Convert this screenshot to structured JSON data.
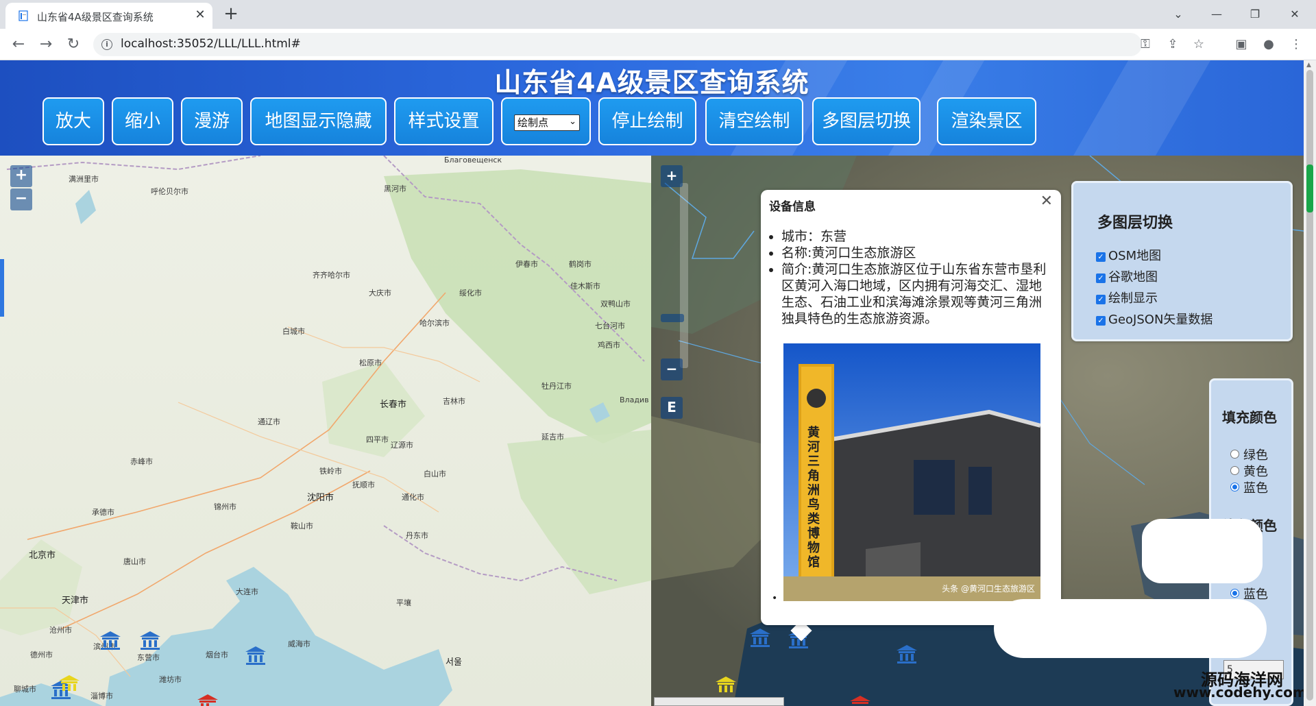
{
  "browser": {
    "tab_title": "山东省4A级景区查询系统",
    "tab_close": "✕",
    "new_tab": "+",
    "url": "localhost:35052/LLL/LLL.html#"
  },
  "header": {
    "title": "山东省4A级景区查询系统",
    "buttons": {
      "zoom_in": "放大",
      "zoom_out": "缩小",
      "pan": "漫游",
      "toggle_map": "地图显示隐藏",
      "style": "样式设置",
      "stop_draw": "停止绘制",
      "clear_draw": "清空绘制",
      "layer_switch": "多图层切换",
      "render_scenic": "渲染景区"
    },
    "draw_select_value": "绘制点"
  },
  "left_map": {
    "zoom_in": "+",
    "zoom_out": "−",
    "labels": [
      {
        "text": "Благовещенск",
        "big": false
      },
      {
        "text": "满洲里市",
        "big": false
      },
      {
        "text": "呼伦贝尔市",
        "big": false
      },
      {
        "text": "黑河市",
        "big": false
      },
      {
        "text": "齐齐哈尔市",
        "big": false
      },
      {
        "text": "大庆市",
        "big": false
      },
      {
        "text": "伊春市",
        "big": false
      },
      {
        "text": "鹤岗市",
        "big": false
      },
      {
        "text": "佳木斯市",
        "big": false
      },
      {
        "text": "双鸭山市",
        "big": false
      },
      {
        "text": "哈尔滨市",
        "big": false
      },
      {
        "text": "绥化市",
        "big": false
      },
      {
        "text": "七台河市",
        "big": false
      },
      {
        "text": "白城市",
        "big": false
      },
      {
        "text": "松原市",
        "big": false
      },
      {
        "text": "鸡西市",
        "big": false
      },
      {
        "text": "牡丹江市",
        "big": false
      },
      {
        "text": "长春市",
        "big": false
      },
      {
        "text": "吉林市",
        "big": false
      },
      {
        "text": "四平市",
        "big": false
      },
      {
        "text": "通辽市",
        "big": false
      },
      {
        "text": "辽源市",
        "big": false
      },
      {
        "text": "延吉市",
        "big": false
      },
      {
        "text": "赤峰市",
        "big": false
      },
      {
        "text": "铁岭市",
        "big": false
      },
      {
        "text": "沈阳市",
        "big": false
      },
      {
        "text": "抚顺市",
        "big": false
      },
      {
        "text": "白山市",
        "big": false
      },
      {
        "text": "通化市",
        "big": false
      },
      {
        "text": "承德市",
        "big": false
      },
      {
        "text": "锦州市",
        "big": false
      },
      {
        "text": "鞍山市",
        "big": false
      },
      {
        "text": "丹东市",
        "big": false
      },
      {
        "text": "北京市",
        "big": true
      },
      {
        "text": "唐山市",
        "big": false
      },
      {
        "text": "天津市",
        "big": true
      },
      {
        "text": "大连市",
        "big": false
      },
      {
        "text": "平壤",
        "big": false
      },
      {
        "text": "沧州市",
        "big": false
      },
      {
        "text": "滨州市",
        "big": false
      },
      {
        "text": "东营市",
        "big": false
      },
      {
        "text": "烟台市",
        "big": false
      },
      {
        "text": "威海市",
        "big": false
      },
      {
        "text": "德州市",
        "big": false
      },
      {
        "text": "淄博市",
        "big": false
      },
      {
        "text": "潍坊市",
        "big": false
      },
      {
        "text": "聊城市",
        "big": false
      },
      {
        "text": "서울",
        "big": false
      },
      {
        "text": "Владив",
        "big": false
      }
    ]
  },
  "right_map": {
    "zoom_in": "+",
    "zoom_out": "−",
    "extent": "E"
  },
  "popup": {
    "title": "设备信息",
    "close": "✕",
    "items": [
      "城市：东营",
      "名称:黄河口生态旅游区",
      "简介:黄河口生态旅游区位于山东省东营市垦利区黄河入海口地域，区内拥有河海交汇、湿地生态、石油工业和滨海滩涂景观等黄河三角洲独具特色的生态旅游资源。"
    ],
    "photo_caption": "头条 @黄河口生态旅游区",
    "photo_sign": "黄河三角洲鸟类博物馆",
    "bullet": "•"
  },
  "layer_panel": {
    "title": "多图层切换",
    "items": [
      "OSM地图",
      "谷歌地图",
      "绘制显示",
      "GeoJSON矢量数据"
    ]
  },
  "color_panel": {
    "fill_title": "填充颜色",
    "fill_options": [
      "绿色",
      "黄色",
      "蓝色"
    ],
    "fill_selected": "蓝色",
    "line_title_partial": "线条颜色",
    "line_option_visible": "蓝色",
    "input_value": "5"
  },
  "watermark": {
    "line1": "源码海洋网",
    "line2": "www.codehy.com"
  },
  "colors": {
    "header_blue": "#2d6be0",
    "button_blue": "#1683dc",
    "panel_bg": "#c5d8ee",
    "checkbox_blue": "#1a73e8"
  }
}
